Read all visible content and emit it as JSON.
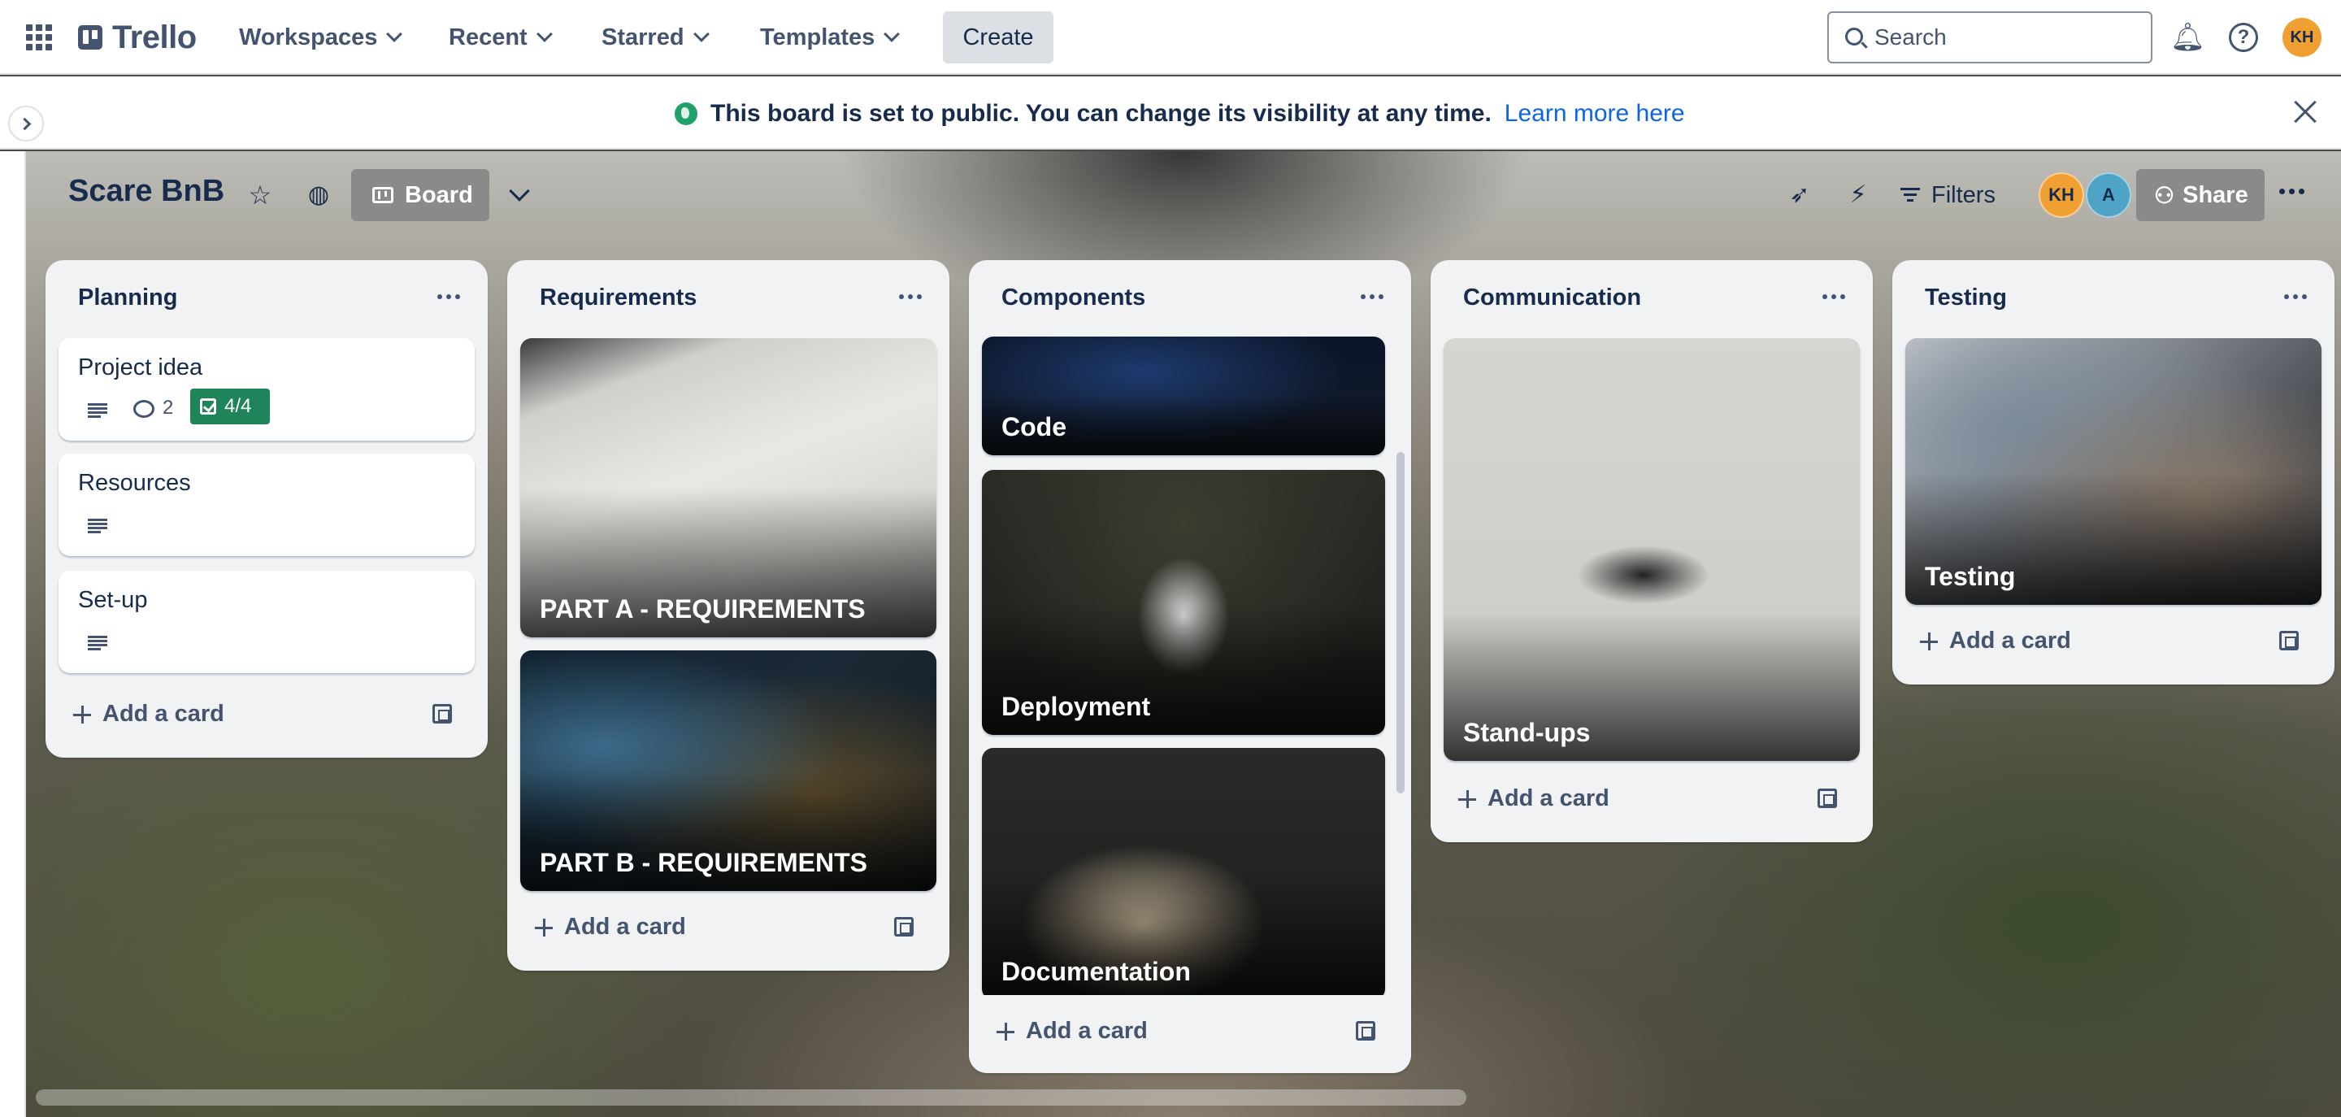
{
  "nav": {
    "logo_text": "Trello",
    "items": [
      {
        "label": "Workspaces"
      },
      {
        "label": "Recent"
      },
      {
        "label": "Starred"
      },
      {
        "label": "Templates"
      }
    ],
    "create_label": "Create",
    "search_placeholder": "Search",
    "user_initials": "KH"
  },
  "banner": {
    "text": "This board is set to public. You can change its visibility at any time.",
    "link": "Learn more here"
  },
  "board": {
    "title": "Scare BnB",
    "view_label": "Board",
    "filters_label": "Filters",
    "share_label": "Share",
    "members": [
      {
        "initials": "KH",
        "color": "#f0a033"
      },
      {
        "initials": "A",
        "color": "#4fa3c7"
      }
    ]
  },
  "lists": [
    {
      "title": "Planning",
      "cards": [
        {
          "title": "Project idea",
          "comments": "2",
          "checklist": "4/4"
        },
        {
          "title": "Resources"
        },
        {
          "title": "Set-up"
        }
      ],
      "add_label": "Add a card"
    },
    {
      "title": "Requirements",
      "cards": [
        {
          "title": "PART A - REQUIREMENTS"
        },
        {
          "title": "PART B - REQUIREMENTS"
        }
      ],
      "add_label": "Add a card"
    },
    {
      "title": "Components",
      "cards": [
        {
          "title": "Code"
        },
        {
          "title": "Deployment"
        },
        {
          "title": "Documentation"
        }
      ],
      "add_label": "Add a card"
    },
    {
      "title": "Communication",
      "cards": [
        {
          "title": "Stand-ups"
        }
      ],
      "add_label": "Add a card"
    },
    {
      "title": "Testing",
      "cards": [
        {
          "title": "Testing"
        }
      ],
      "add_label": "Add a card"
    }
  ],
  "colors": {
    "checklist_complete": "#1f845a",
    "link": "#0c66e4",
    "public_icon": "#22a06b"
  }
}
